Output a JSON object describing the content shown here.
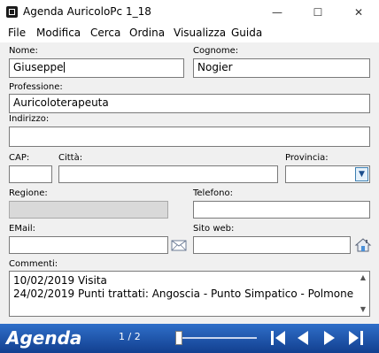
{
  "window": {
    "title": "Agenda AuricoloPc 1_18",
    "minimize": "—",
    "maximize": "☐",
    "close": "✕"
  },
  "menu": [
    "File",
    "Modifica",
    "Cerca",
    "Ordina",
    "Visualizza",
    "Guida"
  ],
  "form": {
    "nome_label": "Nome:",
    "nome_value": "Giuseppe",
    "cognome_label": "Cognome:",
    "cognome_value": "Nogier",
    "professione_label": "Professione:",
    "professione_value": "Auricoloterapeuta",
    "indirizzo_label": "Indirizzo:",
    "indirizzo_value": "",
    "cap_label": "CAP:",
    "cap_value": "",
    "citta_label": "Città:",
    "citta_value": "",
    "provincia_label": "Provincia:",
    "provincia_value": "",
    "regione_label": "Regione:",
    "regione_value": "",
    "telefono_label": "Telefono:",
    "telefono_value": "",
    "email_label": "EMail:",
    "email_value": "",
    "sitoweb_label": "Sito web:",
    "sitoweb_value": "",
    "commenti_label": "Commenti:",
    "commenti_lines": [
      "10/02/2019 Visita",
      "24/02/2019 Punti trattati: Angoscia - Punto Simpatico - Polmone"
    ]
  },
  "bottom": {
    "brand": "Agenda",
    "page_counter": "1 / 2",
    "record_position": 0.0
  },
  "icons": {
    "email": "envelope-icon",
    "website": "house-icon",
    "nav_first": "first-record-icon",
    "nav_prev": "previous-record-icon",
    "nav_next": "next-record-icon",
    "nav_last": "last-record-icon"
  },
  "colors": {
    "bottom_bar": "#1f56b0",
    "disabled_field": "#d9d9d9"
  }
}
